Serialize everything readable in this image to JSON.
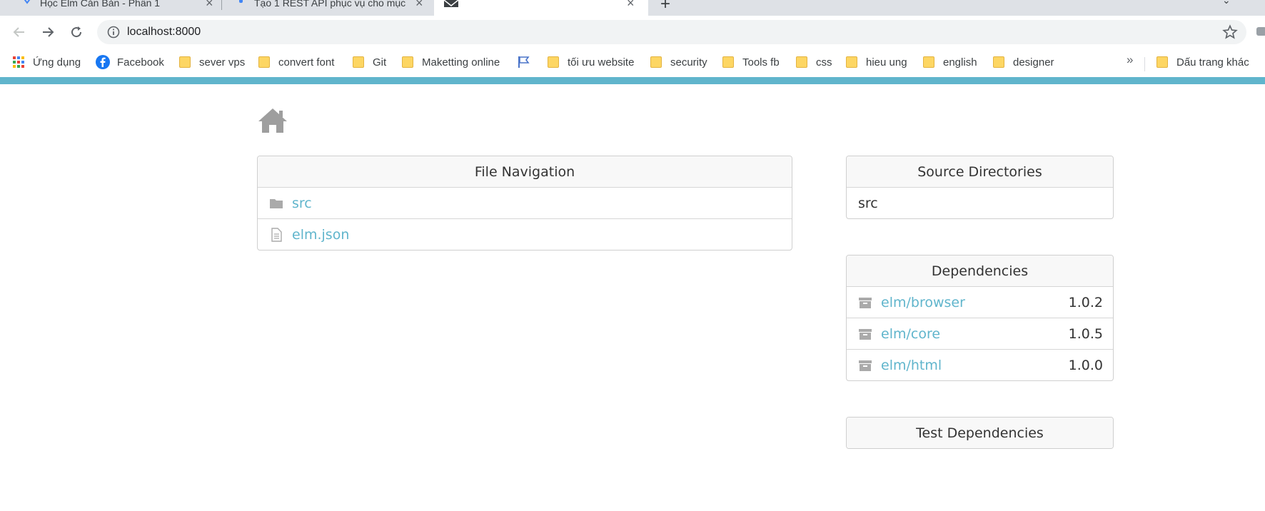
{
  "browser": {
    "tabs": [
      {
        "title": "Học Elm Căn Bản - Phần 1",
        "active": false
      },
      {
        "title": "Tạo 1 REST API phục vụ cho mục",
        "active": false
      },
      {
        "title": "",
        "active": true
      }
    ],
    "address": {
      "url": "localhost:8000"
    },
    "bookmarks": [
      {
        "label": "Ứng dụng",
        "icon": "apps-grid-icon"
      },
      {
        "label": "Facebook",
        "icon": "facebook-icon"
      },
      {
        "label": "sever vps",
        "icon": "folder-icon"
      },
      {
        "label": "convert font",
        "icon": "folder-icon"
      },
      {
        "label": "Git",
        "icon": "folder-icon"
      },
      {
        "label": "Maketting online",
        "icon": "folder-icon"
      },
      {
        "label": "",
        "icon": "flag-icon"
      },
      {
        "label": "tối ưu website",
        "icon": "folder-icon"
      },
      {
        "label": "security",
        "icon": "folder-icon"
      },
      {
        "label": "Tools fb",
        "icon": "folder-icon"
      },
      {
        "label": "css",
        "icon": "folder-icon"
      },
      {
        "label": "hieu ung",
        "icon": "folder-icon"
      },
      {
        "label": "english",
        "icon": "folder-icon"
      },
      {
        "label": "designer",
        "icon": "folder-icon"
      }
    ],
    "bookmarks_more": "»",
    "other_bookmarks": "Dấu trang khác"
  },
  "colors": {
    "accent": "#60b5cc",
    "link": "#60b5cc",
    "icon_gray": "#aaaaaa"
  },
  "page": {
    "home_icon": "home-icon",
    "file_navigation": {
      "title": "File Navigation",
      "items": [
        {
          "name": "src",
          "icon": "folder-icon"
        },
        {
          "name": "elm.json",
          "icon": "file-icon"
        }
      ]
    },
    "source_directories": {
      "title": "Source Directories",
      "items": [
        "src"
      ]
    },
    "dependencies": {
      "title": "Dependencies",
      "items": [
        {
          "name": "elm/browser",
          "version": "1.0.2",
          "icon": "package-icon"
        },
        {
          "name": "elm/core",
          "version": "1.0.5",
          "icon": "package-icon"
        },
        {
          "name": "elm/html",
          "version": "1.0.0",
          "icon": "package-icon"
        }
      ]
    },
    "test_dependencies": {
      "title": "Test Dependencies"
    }
  }
}
